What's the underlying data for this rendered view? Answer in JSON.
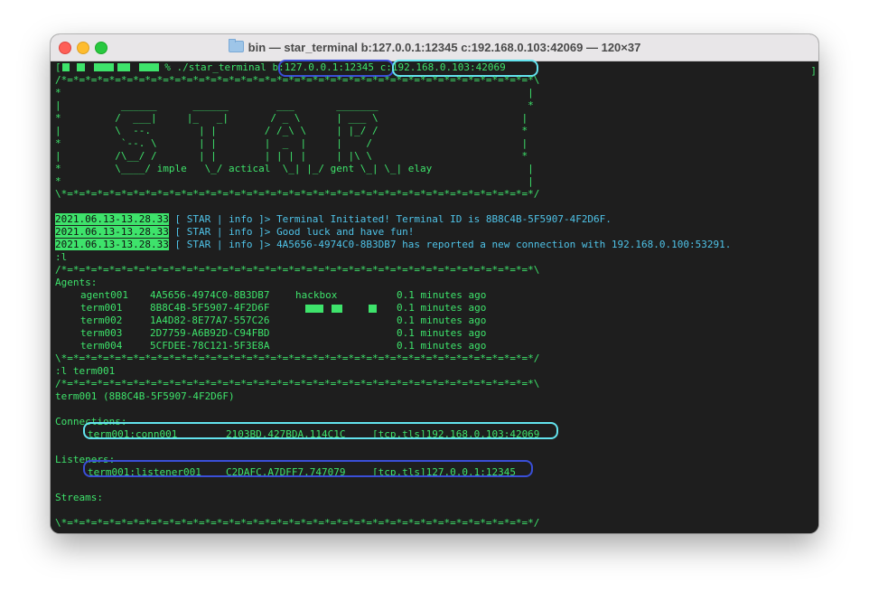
{
  "window": {
    "title": "bin — star_terminal b:127.0.0.1:12345 c:192.168.0.103:42069 — 120×37",
    "folder_icon": "folder-icon",
    "colors": {
      "text": "#3ee36b",
      "info": "#4fc3e8",
      "bg": "#1e1e1e",
      "cyan_ring": "#63e3ee",
      "blue_ring": "#3a4fd8"
    }
  },
  "terminal": {
    "prompt": {
      "suffix": " % ./star_terminal ",
      "bind_arg": "b:127.0.0.1:12345",
      "connect_arg": "c:192.168.0.103:42069"
    },
    "banner": [
      "/*=*=*=*=*=*=*=*=*=*=*=*=*=*=*=*=*=*=*=*=*=*=*=*=*=*=*=*=*=*=*=*=*=*=*=*=*=*=*=*\\",
      "*                                                                              |",
      "|          ______      ______        ___       _______                         *",
      "*         /  ___|     |_   _|       / _ \\      | ___ \\                        |",
      "|         \\  --.        | |        / /_\\ \\     | |_/ /                        *",
      "*          `--. \\       | |        |  _  |     |    /                         |",
      "|         /\\__/ /       | |        | | | |     | |\\ \\                         *",
      "*         \\____/ imple   \\_/ actical  \\_| |_/ gent \\_| \\_| elay                |",
      "*                                                                              |",
      "\\*=*=*=*=*=*=*=*=*=*=*=*=*=*=*=*=*=*=*=*=*=*=*=*=*=*=*=*=*=*=*=*=*=*=*=*=*=*=*=*/"
    ],
    "log": [
      {
        "ts": "2021.06.13-13.28.33",
        "tag": " [ STAR | info ]> ",
        "msg": "Terminal Initiated! Terminal ID is 8B8C4B-5F5907-4F2D6F."
      },
      {
        "ts": "2021.06.13-13.28.33",
        "tag": " [ STAR | info ]> ",
        "msg": "Good luck and have fun!"
      },
      {
        "ts": "2021.06.13-13.28.33",
        "tag": " [ STAR | info ]> ",
        "msg": "4A5656-4974C0-8B3DB7 has reported a new connection with 192.168.0.100:53291."
      }
    ],
    "cmd1": ":l",
    "sep_top": "/*=*=*=*=*=*=*=*=*=*=*=*=*=*=*=*=*=*=*=*=*=*=*=*=*=*=*=*=*=*=*=*=*=*=*=*=*=*=*=*\\",
    "sep_bottom": "\\*=*=*=*=*=*=*=*=*=*=*=*=*=*=*=*=*=*=*=*=*=*=*=*=*=*=*=*=*=*=*=*=*=*=*=*=*=*=*=*/",
    "agents_header": "Agents:",
    "agents": [
      {
        "name": "agent001",
        "id": "4A5656-4974C0-8B3DB7",
        "host": "hackbox",
        "age": "0.1 minutes ago"
      },
      {
        "name": "term001",
        "id": "8B8C4B-5F5907-4F2D6F",
        "host": "",
        "age": "0.1 minutes ago"
      },
      {
        "name": "term002",
        "id": "1A4D82-8E77A7-557C26",
        "host": "",
        "age": "0.1 minutes ago"
      },
      {
        "name": "term003",
        "id": "2D7759-A6B92D-C94FBD",
        "host": "",
        "age": "0.1 minutes ago"
      },
      {
        "name": "term004",
        "id": "5CFDEE-78C121-5F3E8A",
        "host": "",
        "age": "0.1 minutes ago"
      }
    ],
    "cmd2": ":l term001",
    "detail_title": "term001 (8B8C4B-5F5907-4F2D6F)",
    "connections_header": "Connections:",
    "connection": {
      "name": "term001:conn001",
      "id": "2103BD.427BDA.114C1C",
      "addr": "[tcp.tls]192.168.0.103:42069"
    },
    "listeners_header": "Listeners:",
    "listener": {
      "name": "term001:listener001",
      "id": "C2DAFC.A7DFF7.747079",
      "addr": "[tcp.tls]127.0.0.1:12345"
    },
    "streams_header": "Streams:"
  }
}
